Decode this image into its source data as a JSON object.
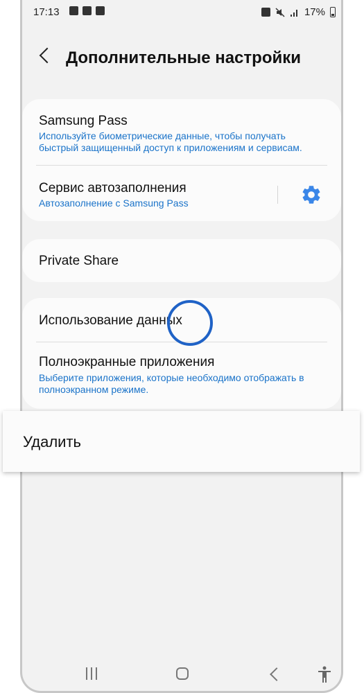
{
  "status_bar": {
    "time": "17:13",
    "battery": "17%"
  },
  "header": {
    "title": "Дополнительные настройки"
  },
  "cards": {
    "samsung_pass": {
      "title": "Samsung Pass",
      "subtitle_line1": "Используйте биометрические данные, чтобы получать",
      "subtitle_line2": "быстрый защищенный доступ к приложениям и сервисам."
    },
    "autofill": {
      "title": "Сервис автозаполнения",
      "subtitle": "Автозаполнение с Samsung Pass"
    },
    "private_share": {
      "title": "Private Share"
    },
    "data_usage": {
      "title": "Использование данных"
    },
    "fullscreen_apps": {
      "title": "Полноэкранные приложения",
      "subtitle_line1": "Выберите приложения, которые необходимо отображать в",
      "subtitle_line2": "полноэкранном режиме."
    }
  },
  "popup": {
    "label": "Удалить"
  },
  "colors": {
    "accent": "#1a73c9",
    "gear": "#3a86e8",
    "touch": "#1f62c6"
  },
  "icons": [
    "back-icon",
    "gear-icon",
    "recent-apps-icon",
    "home-icon",
    "nav-back-icon",
    "accessibility-icon"
  ]
}
